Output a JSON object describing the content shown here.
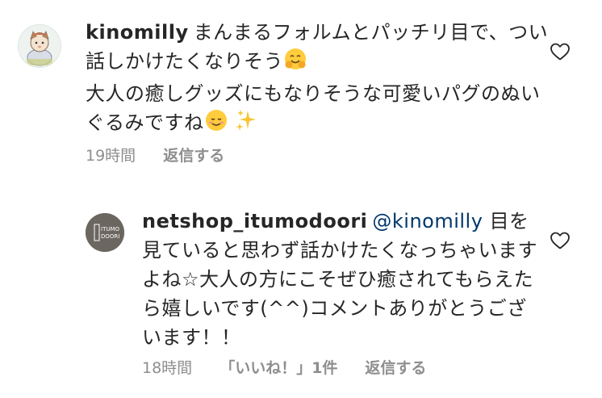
{
  "comments": [
    {
      "username": "kinomilly",
      "text": "まんまるフォルムとパッチリ目で、つい話しかけたくなりそう",
      "emoji1": "hugging-face",
      "text2": "\n大人の癒しグッズにもなりそうな可愛いパグのぬいぐるみですね",
      "emoji2": "smiling-face",
      "emoji3": "sparkles",
      "time": "19時間",
      "reply_label": "返信する"
    },
    {
      "username": "netshop_itumodoori",
      "mention": "@kinomilly",
      "text": "目を見ていると思わず話かけたくなっちゃいますよね☆大人の方にこそぜひ癒されてもらえたら嬉しいです(^^)コメントありがとうございます！！",
      "avatar_text_top": "ITUMO",
      "avatar_text_bottom": "DOORI",
      "time": "18時間",
      "likes_label": "「いいね！」1件",
      "reply_label": "返信する"
    }
  ],
  "colors": {
    "text": "#262626",
    "meta": "#8e8e8e",
    "mention": "#00376b",
    "avatar_brand_bg": "#6b6660"
  }
}
